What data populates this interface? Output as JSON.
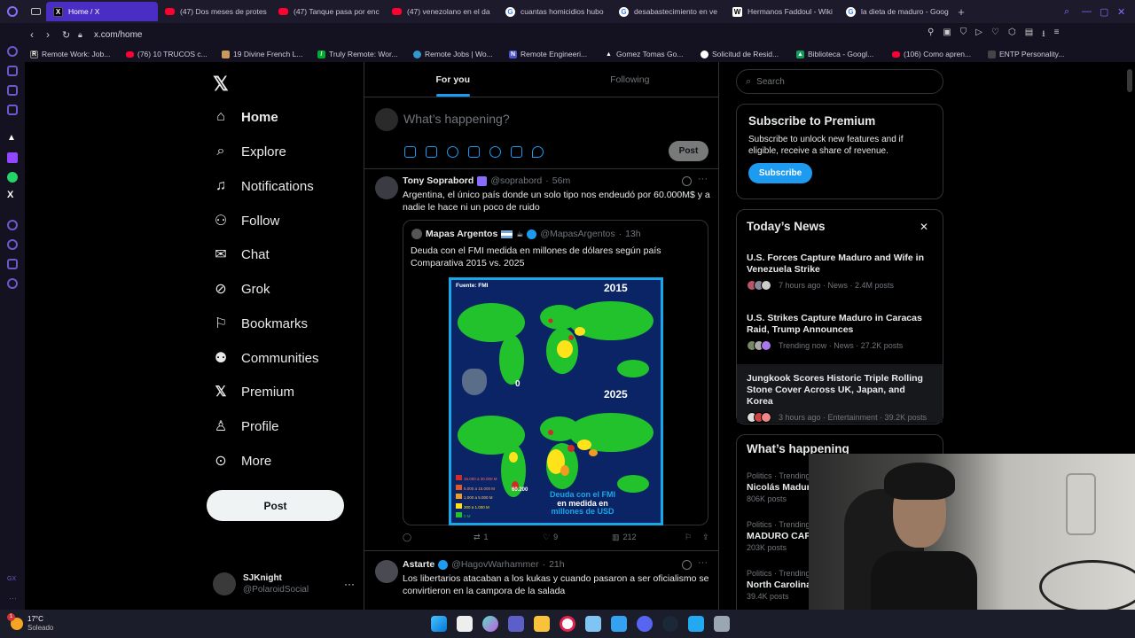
{
  "browser": {
    "tabs": [
      {
        "label": "Home / X",
        "icon": "x-favicon",
        "active": true
      },
      {
        "label": "(47) Dos meses de protes",
        "icon": "youtube-favicon"
      },
      {
        "label": "(47) Tanque pasa por enc",
        "icon": "youtube-favicon"
      },
      {
        "label": "(47) venezolano en el da",
        "icon": "youtube-favicon"
      },
      {
        "label": "cuantas homicidios hubo",
        "icon": "google-favicon"
      },
      {
        "label": "desabastecimiento en ve",
        "icon": "google-favicon"
      },
      {
        "label": "Hermanos Faddoul - Wiki",
        "icon": "wikipedia-favicon"
      },
      {
        "label": "la dieta de maduro - Goog",
        "icon": "google-favicon"
      }
    ],
    "url": "x.com/home",
    "bookmarks": [
      "Remote Work: Job...",
      "(76) 10 TRUCOS c...",
      "19 Divine French L...",
      "Truly Remote: Wor...",
      "Remote Jobs | Wo...",
      "Remote Engineeri...",
      "Gomez Tomas Go...",
      "Solicitud de Resid...",
      "Biblioteca - Googl...",
      "(106) Como apren...",
      "ENTP Personality..."
    ]
  },
  "nav": {
    "items": [
      {
        "label": "Home",
        "icon": "home-icon"
      },
      {
        "label": "Explore",
        "icon": "search-icon"
      },
      {
        "label": "Notifications",
        "icon": "bell-icon"
      },
      {
        "label": "Follow",
        "icon": "follow-icon"
      },
      {
        "label": "Chat",
        "icon": "mail-icon"
      },
      {
        "label": "Grok",
        "icon": "grok-icon"
      },
      {
        "label": "Bookmarks",
        "icon": "bookmark-icon"
      },
      {
        "label": "Communities",
        "icon": "communities-icon"
      },
      {
        "label": "Premium",
        "icon": "x-icon"
      },
      {
        "label": "Profile",
        "icon": "person-icon"
      },
      {
        "label": "More",
        "icon": "more-circle-icon"
      }
    ],
    "post_button": "Post",
    "account": {
      "name": "SJKnight",
      "handle": "@PolaroidSocial"
    }
  },
  "feed": {
    "tabs": [
      "For you",
      "Following"
    ],
    "composer_placeholder": "What’s happening?",
    "composer_post": "Post",
    "tweet1": {
      "name": "Tony Soprabord",
      "handle": "@soprabord",
      "time": "56m",
      "text": "Argentina,  el único país donde un solo tipo nos endeudó por 60.000M$ y a nadie le hace ni un poco de ruido",
      "quote": {
        "name": "Mapas Argentos",
        "handle": "@MapasArgentos",
        "time": "13h",
        "text1": "Deuda con el FMI medida en millones de dólares según país",
        "text2": "Comparativa 2015 vs. 2025",
        "image": {
          "source": "Fuente: FMI",
          "year_top": "2015",
          "year_bottom": "2025",
          "zero": "0",
          "label_a": "60.200",
          "caption1": "Deuda con el FMI",
          "caption2": "en medida en",
          "caption3": "millones de USD",
          "legend": [
            "15.000 a 30.000 M",
            "5.000 a 15.000 M",
            "1.000 a 5.000 M",
            "300 a 1.000 M",
            "0 M"
          ]
        }
      },
      "stats": {
        "retweets": "1",
        "likes": "9",
        "views": "212"
      }
    },
    "tweet2": {
      "name": "Astarte",
      "handle": "@HagovWarhammer",
      "time": "21h",
      "text": "Los libertarios atacaban a los kukas y cuando pasaron a ser oficialismo se convirtieron en la campora de la salada"
    }
  },
  "sidebar": {
    "search_placeholder": "Search",
    "premium": {
      "title": "Subscribe to Premium",
      "text": "Subscribe to unlock new features and if eligible, receive a share of revenue.",
      "button": "Subscribe"
    },
    "news": {
      "title": "Today’s News",
      "items": [
        {
          "title": "U.S. Forces Capture Maduro and Wife in Venezuela Strike",
          "meta": "7 hours ago · News · 2.4M posts"
        },
        {
          "title": "U.S. Strikes Capture Maduro in Caracas Raid, Trump Announces",
          "meta": "Trending now · News · 27.2K posts"
        },
        {
          "title": "Jungkook Scores Historic Triple Rolling Stone Cover Across UK, Japan, and Korea",
          "meta": "3 hours ago · Entertainment · 39.2K posts"
        }
      ]
    },
    "happening": {
      "title": "What’s happening",
      "items": [
        {
          "context": "Politics · Trending",
          "name": "Nicolás Madur",
          "posts": "806K posts"
        },
        {
          "context": "Politics · Trending",
          "name": "MADURO CAP",
          "posts": "203K posts"
        },
        {
          "context": "Politics · Trending",
          "name": "North Carolina",
          "posts": "39.4K posts"
        }
      ]
    }
  },
  "taskbar": {
    "weather_temp": "17°C",
    "weather_desc": "Soleado",
    "notification_badge": "1"
  },
  "colors": {
    "accent": "#1d9bf0",
    "browser_accent": "#4a2ec4"
  }
}
